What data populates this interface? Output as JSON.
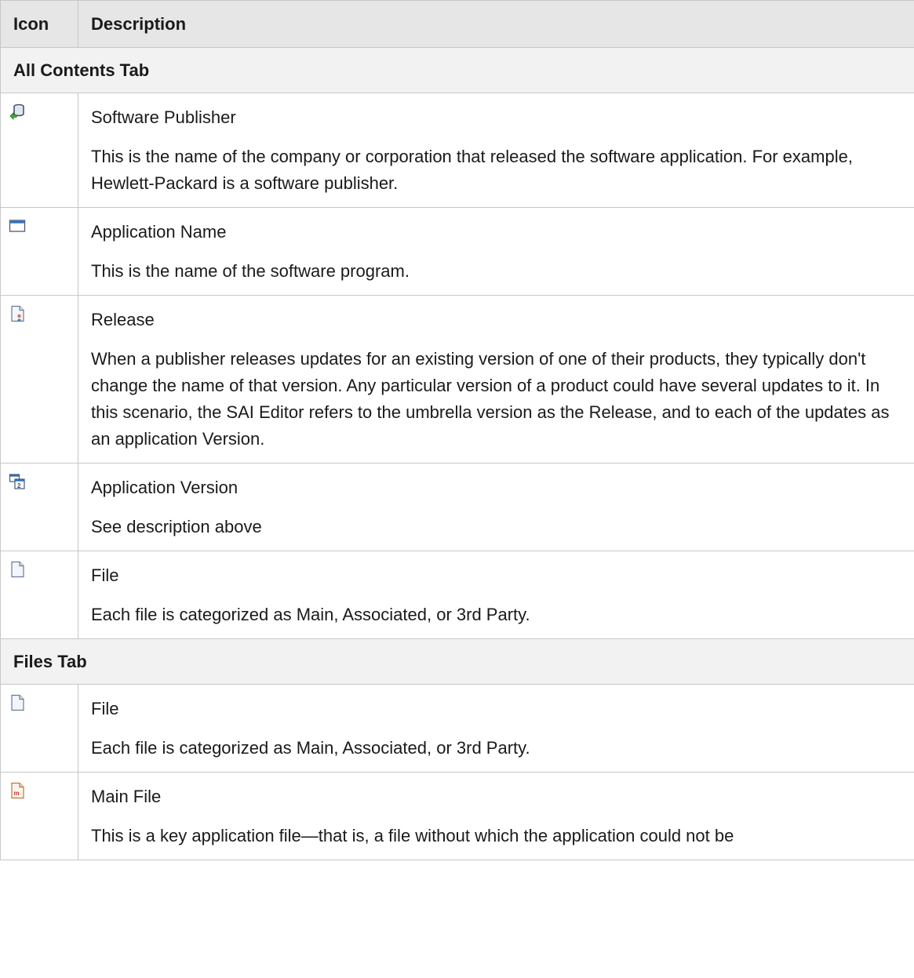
{
  "table": {
    "headers": {
      "icon": "Icon",
      "description": "Description"
    },
    "sections": [
      {
        "title": "All Contents Tab",
        "rows": [
          {
            "icon": "software-publisher-icon",
            "name": "Software Publisher",
            "description": "This is the name of the company or corporation that released the software application. For example, Hewlett-Packard is a software publisher."
          },
          {
            "icon": "application-name-icon",
            "name": "Application Name",
            "description": "This is the name of the software program."
          },
          {
            "icon": "release-icon",
            "name": "Release",
            "description": "When a publisher releases updates for an existing version of one of their products, they typically don't change the name of that version. Any particular version of a product could have several updates to it. In this scenario, the SAI Editor refers to the umbrella version as the Release, and to each of the updates as an application Version."
          },
          {
            "icon": "application-version-icon",
            "name": "Application Version",
            "description": "See description above"
          },
          {
            "icon": "file-icon",
            "name": "File",
            "description": "Each file is categorized as Main, Associated, or 3rd Party."
          }
        ]
      },
      {
        "title": "Files Tab",
        "rows": [
          {
            "icon": "file-icon",
            "name": "File",
            "description": "Each file is categorized as Main, Associated, or 3rd Party."
          },
          {
            "icon": "main-file-icon",
            "name": "Main File",
            "description": "This is a key application file—that is, a file without which the application could not be"
          }
        ]
      }
    ]
  }
}
